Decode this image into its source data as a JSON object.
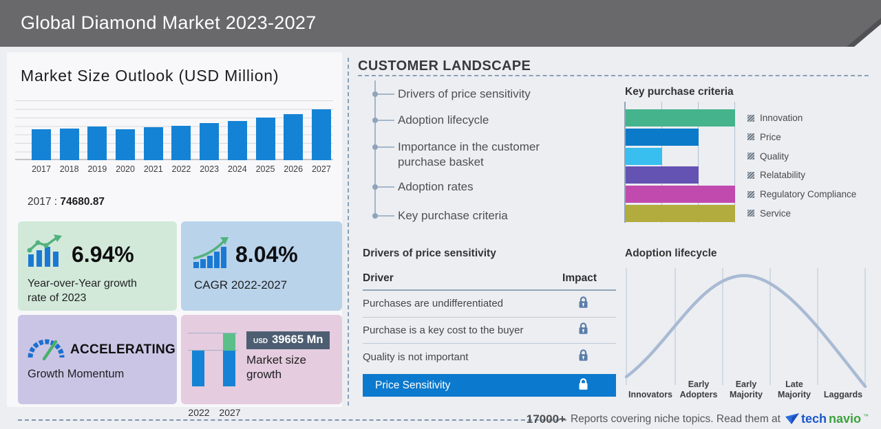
{
  "header": {
    "title": "Global Diamond Market 2023-2027"
  },
  "market_outlook": {
    "callout_year": "2017",
    "callout_sep": " : ",
    "callout_value": "74680.87"
  },
  "stats": {
    "yoy": {
      "value": "6.94%",
      "label": "Year-over-Year growth rate of 2023"
    },
    "cagr": {
      "value": "8.04%",
      "label": "CAGR 2022-2027"
    },
    "momentum": {
      "value": "ACCELERATING",
      "label": "Growth Momentum"
    },
    "growth": {
      "currency": "USD",
      "amount": "39665 Mn",
      "label": "Market size growth"
    }
  },
  "customer_landscape": {
    "title": "CUSTOMER LANDSCAPE",
    "items": [
      "Drivers of price sensitivity",
      "Adoption lifecycle",
      "Importance in the customer purchase basket",
      "Adoption rates",
      "Key purchase criteria"
    ]
  },
  "price_sensitivity": {
    "title": "Drivers of price sensitivity",
    "col_driver": "Driver",
    "col_impact": "Impact",
    "rows": [
      "Purchases are undifferentiated",
      "Purchase is a key cost to the buyer",
      "Quality is not important"
    ],
    "highlight": "Price Sensitivity"
  },
  "footer": {
    "count": "17000+",
    "text": "Reports covering niche topics. Read them at",
    "brand_tech": "tech",
    "brand_navio": "navio",
    "brand_tm": "™"
  },
  "colors": {
    "header_bg": "#69696b",
    "bar_blue": "#1583d5",
    "highlight_row": "#0b79cd",
    "lock": "#5b7da9",
    "box_green": "#d2e9da",
    "box_blue": "#b9d3ea",
    "box_purple": "#cbc5e5",
    "box_pink": "#e5ccdf"
  },
  "chart_data": [
    {
      "type": "bar",
      "title": "Market Size Outlook (USD Million)",
      "categories": [
        "2017",
        "2018",
        "2019",
        "2020",
        "2021",
        "2022",
        "2023",
        "2024",
        "2025",
        "2026",
        "2027"
      ],
      "values": [
        74680.87,
        77600,
        82500,
        75600,
        79900,
        83950,
        89800,
        96000,
        103400,
        112600,
        123615
      ],
      "labeled_point": "2017 : 74680.87",
      "note": "only 2017 labeled on chart; other values estimated from bar heights",
      "bar_color": "#1583d5",
      "ylim": [
        0,
        130000
      ],
      "grid": true
    },
    {
      "type": "bar",
      "orientation": "horizontal",
      "title": "Key purchase criteria",
      "categories": [
        "Innovation",
        "Price",
        "Quality",
        "Relatability",
        "Regulatory Compliance",
        "Service"
      ],
      "values": [
        3,
        2,
        1,
        2,
        3,
        3
      ],
      "xlim": [
        0,
        3
      ],
      "note": "values in relative units estimated from gridlines",
      "colors": [
        "#45b38c",
        "#0b7ac9",
        "#38bff0",
        "#6453b2",
        "#c14aae",
        "#b2ac3e"
      ],
      "legend_position": "right"
    },
    {
      "type": "area",
      "title": "Adoption lifecycle",
      "categories": [
        "Innovators",
        "Early Adopters",
        "Early Majority",
        "Late Majority",
        "Laggards"
      ],
      "curve": "bell",
      "peak_stage": "Early Majority",
      "line_color": "#a9bad3"
    },
    {
      "type": "bar",
      "title": "Market size growth",
      "categories": [
        "2022",
        "2027"
      ],
      "values": [
        83950,
        123615
      ],
      "growth_amount": "USD 39665 Mn",
      "colors": [
        "#1583d5",
        "#5bbf8a"
      ]
    }
  ]
}
